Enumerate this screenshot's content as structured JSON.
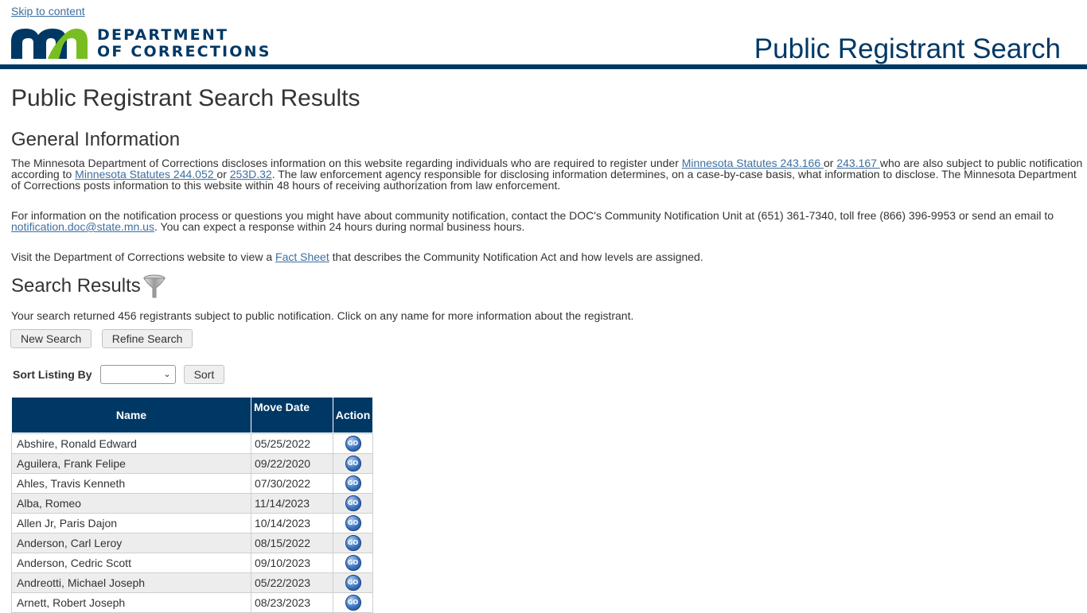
{
  "skip_link": "Skip to content",
  "logo": {
    "line1": "DEPARTMENT",
    "line2": "OF CORRECTIONS"
  },
  "header": {
    "title": "Public Registrant Search"
  },
  "page_title": "Public Registrant Search Results",
  "general": {
    "heading": "General Information",
    "p1": {
      "t1": "The Minnesota Department of Corrections discloses information on this website regarding individuals who are required to register under ",
      "link1": "Minnesota Statutes 243.166 ",
      "t2": "or ",
      "link2": "243.167 ",
      "t3": "who are also subject to public notification according to ",
      "link3": "Minnesota Statutes 244.052 ",
      "t4": "or ",
      "link4": "253D.32",
      "t5": ". The law enforcement agency responsible for disclosing information determines, on a case-by-case basis, what information to disclose. The Minnesota Department of Corrections posts information to this website within 48 hours of receiving authorization from law enforcement."
    },
    "p2": {
      "t1": "For information on the notification process or questions you might have about community notification, contact the DOC's Community Notification Unit at (651) 361-7340, toll free (866) 396-9953 or send an email to ",
      "link1": "notification.doc@state.mn.us",
      "t2": ". You can expect a response within 24 hours during normal business hours."
    },
    "p3": {
      "t1": "Visit the Department of Corrections website to view a ",
      "link1": "Fact Sheet",
      "t2": " that describes the Community Notification Act and how levels are assigned."
    }
  },
  "results": {
    "heading": "Search Results",
    "summary": "Your search returned 456 registrants subject to public notification. Click on any name for more information about the registrant.",
    "new_search": "New Search",
    "refine_search": "Refine Search",
    "sort_label": "Sort Listing By",
    "sort_selected": "",
    "sort_button": "Sort"
  },
  "table": {
    "headers": {
      "name": "Name",
      "move_date": "Move Date",
      "action": "Action"
    },
    "go_label": "GO",
    "rows": [
      {
        "name": "Abshire, Ronald Edward",
        "date": "05/25/2022"
      },
      {
        "name": "Aguilera, Frank Felipe",
        "date": "09/22/2020"
      },
      {
        "name": "Ahles, Travis Kenneth",
        "date": "07/30/2022"
      },
      {
        "name": "Alba, Romeo",
        "date": "11/14/2023"
      },
      {
        "name": "Allen Jr, Paris Dajon",
        "date": "10/14/2023"
      },
      {
        "name": "Anderson, Carl Leroy",
        "date": "08/15/2022"
      },
      {
        "name": "Anderson, Cedric Scott",
        "date": "09/10/2023"
      },
      {
        "name": "Andreotti, Michael Joseph",
        "date": "05/22/2023"
      },
      {
        "name": "Arnett, Robert Joseph",
        "date": "08/23/2023"
      }
    ]
  },
  "colors": {
    "navy": "#003865",
    "green": "#78be21",
    "link": "#3d6fa0"
  }
}
